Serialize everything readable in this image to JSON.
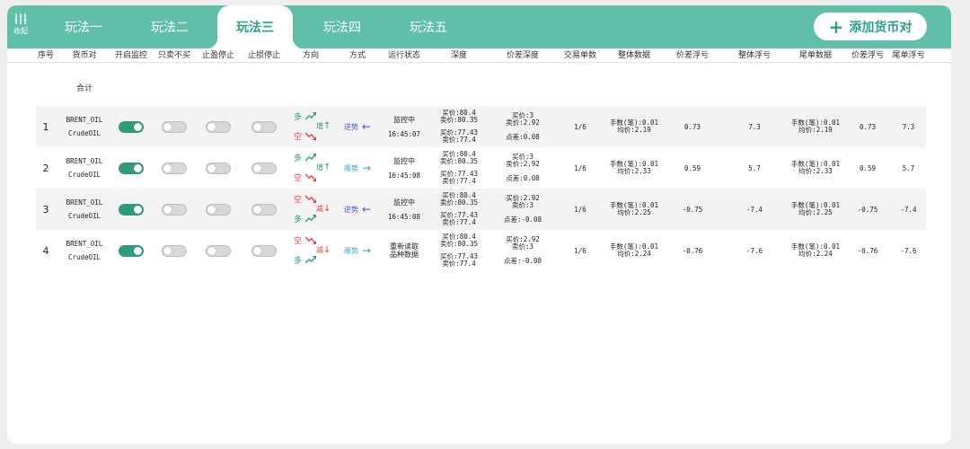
{
  "header": {
    "collapse_label": "收起",
    "tabs": [
      "玩法一",
      "玩法二",
      "玩法三",
      "玩法四",
      "玩法五"
    ],
    "active_tab": "玩法三",
    "add_button_label": "添加货币对",
    "accent_color": "#5fbfa8"
  },
  "columns": [
    "序号",
    "货币对",
    "开启监控",
    "只卖不买",
    "止盈停止",
    "止损停止",
    "方向",
    "方式",
    "运行状态",
    "深度",
    "价差深度",
    "交易单数",
    "整体数据",
    "价差浮亏",
    "整体浮亏",
    "尾单数据",
    "价差浮亏",
    "尾单浮亏"
  ],
  "total_label": "合计",
  "rows": [
    {
      "seq": "1",
      "pair1": "BRENT_OIL",
      "pair2": "CrudeOIL",
      "toggles": [
        true,
        false,
        false,
        false
      ],
      "dir_top": "多",
      "dir_bottom": "空",
      "action": "增",
      "action_type": "increase",
      "mode": "逆势",
      "mode_arrow": "←",
      "mode_type": "reverse",
      "status": "监控中",
      "time": "16:45:07",
      "depth_buy": "买价:80.4",
      "depth_sell": "卖价:80.35",
      "depth_buy2": "买价:77.43",
      "depth_sell2": "卖价:77.4",
      "spread_buy": "买价:3",
      "spread_sell": "卖价:2.92",
      "spread_diff": "点差:0.08",
      "orders": "1/6",
      "total_lots": "手数(笔):0.01",
      "total_avg": "均价:2.19",
      "spread_loss": "0.73",
      "total_loss": "7.3",
      "tail_lots": "手数(笔):0.01",
      "tail_avg": "均价:2.19",
      "spread_loss2": "0.73",
      "tail_loss": "7.3"
    },
    {
      "seq": "2",
      "pair1": "BRENT_OIL",
      "pair2": "CrudeOIL",
      "toggles": [
        true,
        false,
        false,
        false
      ],
      "dir_top": "多",
      "dir_bottom": "空",
      "action": "增",
      "action_type": "increase",
      "mode": "顺势",
      "mode_arrow": "→",
      "mode_type": "forward",
      "status": "监控中",
      "time": "16:45:08",
      "depth_buy": "买价:80.4",
      "depth_sell": "卖价:80.35",
      "depth_buy2": "买价:77.43",
      "depth_sell2": "卖价:77.4",
      "spread_buy": "买价:3",
      "spread_sell": "卖价:2.92",
      "spread_diff": "点差:0.08",
      "orders": "1/6",
      "total_lots": "手数(笔):0.01",
      "total_avg": "均价:2.33",
      "spread_loss": "0.59",
      "total_loss": "5.7",
      "tail_lots": "手数(笔):0.01",
      "tail_avg": "均价:2.33",
      "spread_loss2": "0.59",
      "tail_loss": "5.7"
    },
    {
      "seq": "3",
      "pair1": "BRENT_OIL",
      "pair2": "CrudeOIL",
      "toggles": [
        true,
        false,
        false,
        false
      ],
      "dir_top": "空",
      "dir_bottom": "多",
      "action": "减",
      "action_type": "decrease",
      "mode": "逆势",
      "mode_arrow": "←",
      "mode_type": "reverse",
      "status": "监控中",
      "time": "16:45:08",
      "depth_buy": "买价:80.4",
      "depth_sell": "卖价:80.35",
      "depth_buy2": "买价:77.43",
      "depth_sell2": "卖价:77.4",
      "spread_buy": "买价:2.92",
      "spread_sell": "卖价:3",
      "spread_diff": "点差:-0.08",
      "orders": "1/6",
      "total_lots": "手数(笔):0.01",
      "total_avg": "均价:2.25",
      "spread_loss": "-0.75",
      "total_loss": "-7.4",
      "tail_lots": "手数(笔):0.01",
      "tail_avg": "均价:2.25",
      "spread_loss2": "-0.75",
      "tail_loss": "-7.4"
    },
    {
      "seq": "4",
      "pair1": "BRENT_OIL",
      "pair2": "CrudeOIL",
      "toggles": [
        true,
        false,
        false,
        false
      ],
      "dir_top": "空",
      "dir_bottom": "多",
      "action": "减",
      "action_type": "decrease",
      "mode": "顺势",
      "mode_arrow": "→",
      "mode_type": "forward",
      "status": "重新读取品种数据",
      "time": "",
      "depth_buy": "买价:80.4",
      "depth_sell": "卖价:80.35",
      "depth_buy2": "买价:77.43",
      "depth_sell2": "卖价:77.4",
      "spread_buy": "买价:2.92",
      "spread_sell": "卖价:3",
      "spread_diff": "点差:-0.08",
      "orders": "1/6",
      "total_lots": "手数(笔):0.01",
      "total_avg": "均价:2.24",
      "spread_loss": "-0.76",
      "total_loss": "-7.6",
      "tail_lots": "手数(笔):0.01",
      "tail_avg": "均价:2.24",
      "spread_loss2": "-0.76",
      "tail_loss": "-7.6"
    }
  ]
}
